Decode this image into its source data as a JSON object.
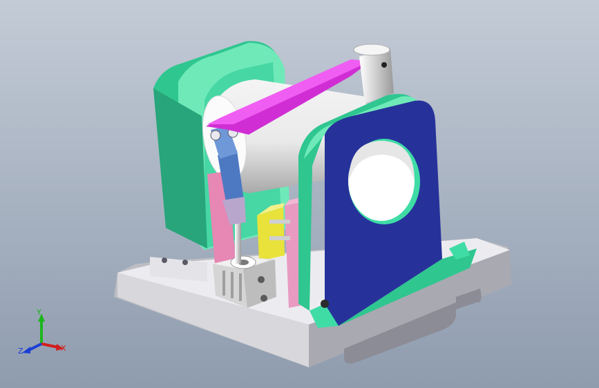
{
  "viewport": {
    "background_top": "#c3cbd6",
    "background_bottom": "#8f9cae"
  },
  "model": {
    "parts": [
      {
        "name": "base-plate",
        "color": "#e4e4e8"
      },
      {
        "name": "left-support-frame",
        "color": "#3fdca6"
      },
      {
        "name": "right-support-bracket",
        "color": "#26329a"
      },
      {
        "name": "cylinder-drum",
        "color": "#f2f2f2"
      },
      {
        "name": "linkage-arm",
        "color": "#e23ee6"
      },
      {
        "name": "pivot-rod",
        "color": "#e6e6e6"
      },
      {
        "name": "clevis-rod-end",
        "color": "#4d79c2"
      },
      {
        "name": "pink-guide-plate",
        "color": "#e687b4"
      },
      {
        "name": "yellow-block",
        "color": "#e8e23a"
      },
      {
        "name": "air-cylinder",
        "color": "#dcdcdc"
      }
    ]
  },
  "triad": {
    "x_label": "X",
    "y_label": "Y",
    "z_label": "Z",
    "x_color": "#d21e1e",
    "y_color": "#1db51d",
    "z_color": "#1b3fd6"
  }
}
